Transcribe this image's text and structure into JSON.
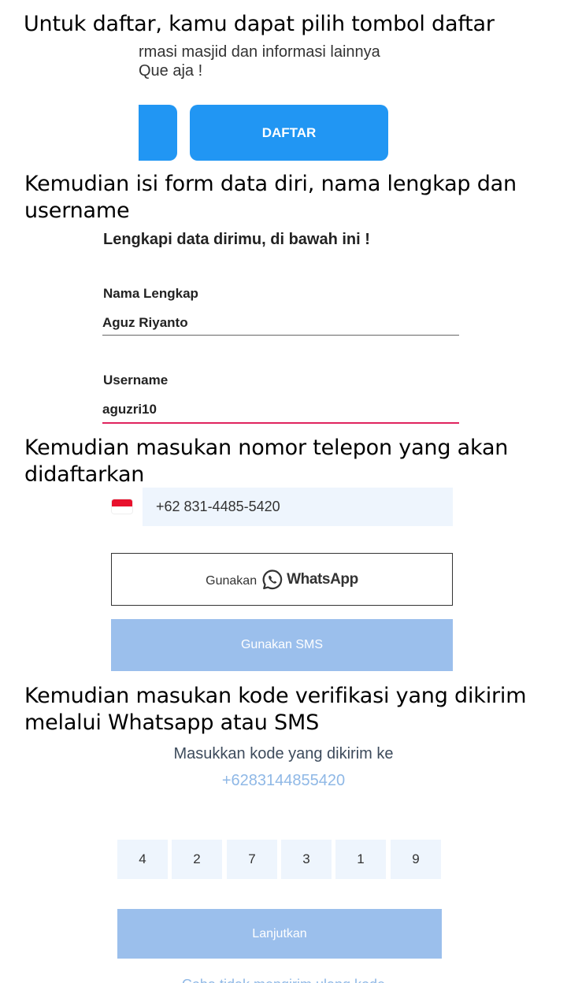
{
  "captions": {
    "step1": "Untuk daftar, kamu dapat pilih tombol daftar",
    "step2": "Kemudian isi form data diri, nama lengkap dan username",
    "step3": "Kemudian masukan nomor telepon yang akan didaftarkan",
    "step4": "Kemudian masukan kode verifikasi yang dikirim melalui Whatsapp atau SMS"
  },
  "snippet1": {
    "line1": "rmasi masjid dan informasi lainnya",
    "line2": "Que aja !",
    "register_label": "DAFTAR"
  },
  "form": {
    "heading": "Lengkapi data dirimu, di bawah ini !",
    "fullname_label": "Nama Lengkap",
    "fullname_value": "Aguz Riyanto",
    "username_label": "Username",
    "username_value": "aguzri10"
  },
  "phone": {
    "country_flag": "indonesia-flag",
    "number": "+62 831-4485-5420",
    "whatsapp_prefix": "Gunakan",
    "whatsapp_brand": "WhatsApp",
    "sms_label": "Gunakan SMS"
  },
  "verification": {
    "title": "Masukkan kode yang dikirim ke",
    "phone": "+6283144855420",
    "digits": [
      "4",
      "2",
      "7",
      "3",
      "1",
      "9"
    ],
    "continue_label": "Lanjutkan",
    "resend_partial": "Coba tidak mengirim ulang kode"
  },
  "colors": {
    "primary_blue": "#2196f3",
    "disabled_blue": "#9bbfec",
    "focus_underline": "#e0245e",
    "input_bg": "#eef5fd"
  }
}
